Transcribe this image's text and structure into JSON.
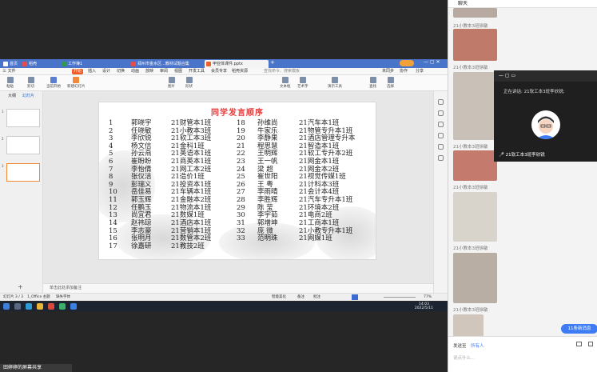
{
  "chat_panel": {
    "title": "聊天",
    "msg_label": "21小教本3班徐敏",
    "new_messages": "11条新消息",
    "send_to_label": "发送至",
    "send_to_value": "所有人",
    "input_placeholder": "说点什么..."
  },
  "speaker": {
    "now_speaking": "正在讲话: 21软工本3班李欣锐;",
    "name_label": "21软工本3班李欣锐"
  },
  "bottom_left_name": "田婷婷的屏幕共享",
  "wps": {
    "tabs": [
      "首页",
      "稻壳",
      "工作簿1",
      "郑州市金水区...教材试题合集",
      "甲亚体课件.pptx"
    ],
    "menu": [
      "三 文件",
      "开始",
      "插入",
      "设计",
      "切换",
      "动画",
      "放映",
      "审阅",
      "视图",
      "开发工具",
      "会员专享",
      "稻壳资源"
    ],
    "search_placeholder": "查找命令、搜索模板",
    "right_actions": [
      "未同步",
      "协作",
      "分享"
    ],
    "ribbon": [
      "粘贴",
      "剪切",
      "复制",
      "格式刷",
      "当前开始",
      "新建幻灯片",
      "版式",
      "节",
      "重置",
      "图片",
      "形状",
      "排列",
      "文本框",
      "艺术字",
      "演示工具",
      "查找",
      "替换",
      "选择"
    ],
    "side_tabs": [
      "大纲",
      "幻灯片"
    ],
    "thumb_labels": [
      "同学发言顺序"
    ],
    "notes_placeholder": "单击此处添加备注",
    "status": [
      "幻灯片 3 / 3",
      "1_Office 主题",
      "缺失字体",
      "智能美化",
      "备注",
      "批注",
      "77%"
    ],
    "time": "14:03",
    "date": "2022/5/11"
  },
  "slide": {
    "title": "同学发言顺序",
    "left": [
      {
        "num": "1",
        "name": "郭晓宇",
        "class": "21财管本1班"
      },
      {
        "num": "2",
        "name": "任晓敏",
        "class": "21小教本3班"
      },
      {
        "num": "3",
        "name": "李欣锐",
        "class": "21软工本3班"
      },
      {
        "num": "4",
        "name": "杨文信",
        "class": "21金科1班"
      },
      {
        "num": "5",
        "name": "孙云燕",
        "class": "21英语本1班"
      },
      {
        "num": "6",
        "name": "崔盼盼",
        "class": "21商英本1班"
      },
      {
        "num": "7",
        "name": "李怡倩",
        "class": "21网工本2班"
      },
      {
        "num": "8",
        "name": "张仪洁",
        "class": "21造价1班"
      },
      {
        "num": "9",
        "name": "彭瑞义",
        "class": "21投资本1班"
      },
      {
        "num": "10",
        "name": "岳佳易",
        "class": "21车辆本1班"
      },
      {
        "num": "11",
        "name": "郭玉辉",
        "class": "21金融本2班"
      },
      {
        "num": "12",
        "name": "任鹏玉",
        "class": "21物流本1班"
      },
      {
        "num": "13",
        "name": "尚宜君",
        "class": "21数媒1班"
      },
      {
        "num": "14",
        "name": "赵祎琼",
        "class": "21酒店本1班"
      },
      {
        "num": "15",
        "name": "李志豪",
        "class": "21营销本1班"
      },
      {
        "num": "16",
        "name": "张明月",
        "class": "21数管本2班"
      },
      {
        "num": "17",
        "name": "徐嘉研",
        "class": "21教技2班"
      }
    ],
    "right": [
      {
        "num": "18",
        "name": "孙维尚",
        "class": "21汽车本1班"
      },
      {
        "num": "19",
        "name": "牛家乐",
        "class": "21物管专升本1班"
      },
      {
        "num": "20",
        "name": "李静果",
        "class": "21酒店管理专升本"
      },
      {
        "num": "21",
        "name": "程思慧",
        "class": "21智造本1班"
      },
      {
        "num": "22",
        "name": "王明辉",
        "class": "21软工专升本2班"
      },
      {
        "num": "23",
        "name": "王一帆",
        "class": "21网金本1班"
      },
      {
        "num": "24",
        "name": "梁 超",
        "class": "21网金本2班"
      },
      {
        "num": "25",
        "name": "崔世阳",
        "class": "21视觉传媒1班"
      },
      {
        "num": "26",
        "name": "王 粤",
        "class": "21计科本3班"
      },
      {
        "num": "27",
        "name": "李雨晴",
        "class": "21会计本4班"
      },
      {
        "num": "28",
        "name": "李胜辉",
        "class": "21汽车专升本1班"
      },
      {
        "num": "29",
        "name": "陈 莹",
        "class": "21环境本2班"
      },
      {
        "num": "30",
        "name": "李宇茹",
        "class": "21电商2班"
      },
      {
        "num": "31",
        "name": "郭增坤",
        "class": "21工商本1班"
      },
      {
        "num": "32",
        "name": "庞 微",
        "class": "21小教专升本1班"
      },
      {
        "num": "33",
        "name": "范明珠",
        "class": "21网媒1班"
      }
    ]
  }
}
